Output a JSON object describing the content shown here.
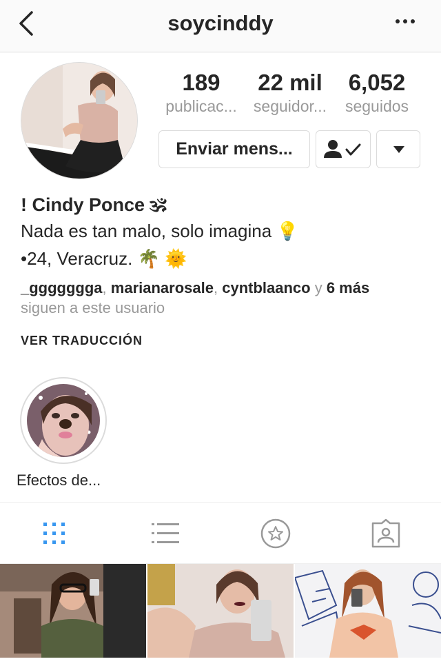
{
  "header": {
    "title": "soycinddy",
    "back_icon": "chevron-left-icon",
    "more_icon": "ellipsis-icon"
  },
  "profile": {
    "avatar_icon": "profile-photo",
    "stats": [
      {
        "value": "189",
        "label": "publicac..."
      },
      {
        "value": "22 mil",
        "label": "seguidor..."
      },
      {
        "value": "6,052",
        "label": "seguidos"
      }
    ],
    "buttons": {
      "message_label": "Enviar mens...",
      "follow_icon": "person-check-icon",
      "dropdown_icon": "triangle-down-icon"
    },
    "name": "!   Cindy Ponce 🕉",
    "bio_line1": "Nada es tan malo, solo imagina 💡",
    "bio_line2": "•24, Veracruz. 🌴 🌞",
    "followed_by": {
      "user1": "_ggggggga",
      "sep1": ", ",
      "user2": "marianarosale",
      "sep2": ", ",
      "user3": "cyntblaanco",
      "conj": " y ",
      "more": "6 más",
      "suffix": "siguen a este usuario"
    },
    "translate_label": "VER TRADUCCIÓN"
  },
  "highlights": [
    {
      "label": "Efectos de..."
    }
  ],
  "tabs": [
    {
      "name": "grid",
      "icon": "grid-icon",
      "active": true
    },
    {
      "name": "list",
      "icon": "list-icon",
      "active": false
    },
    {
      "name": "saved",
      "icon": "star-circle-icon",
      "active": false
    },
    {
      "name": "tagged",
      "icon": "tagged-person-icon",
      "active": false
    }
  ],
  "colors": {
    "accent": "#3897f0",
    "text": "#262626",
    "muted": "#999999",
    "border": "#dbdbdb"
  }
}
